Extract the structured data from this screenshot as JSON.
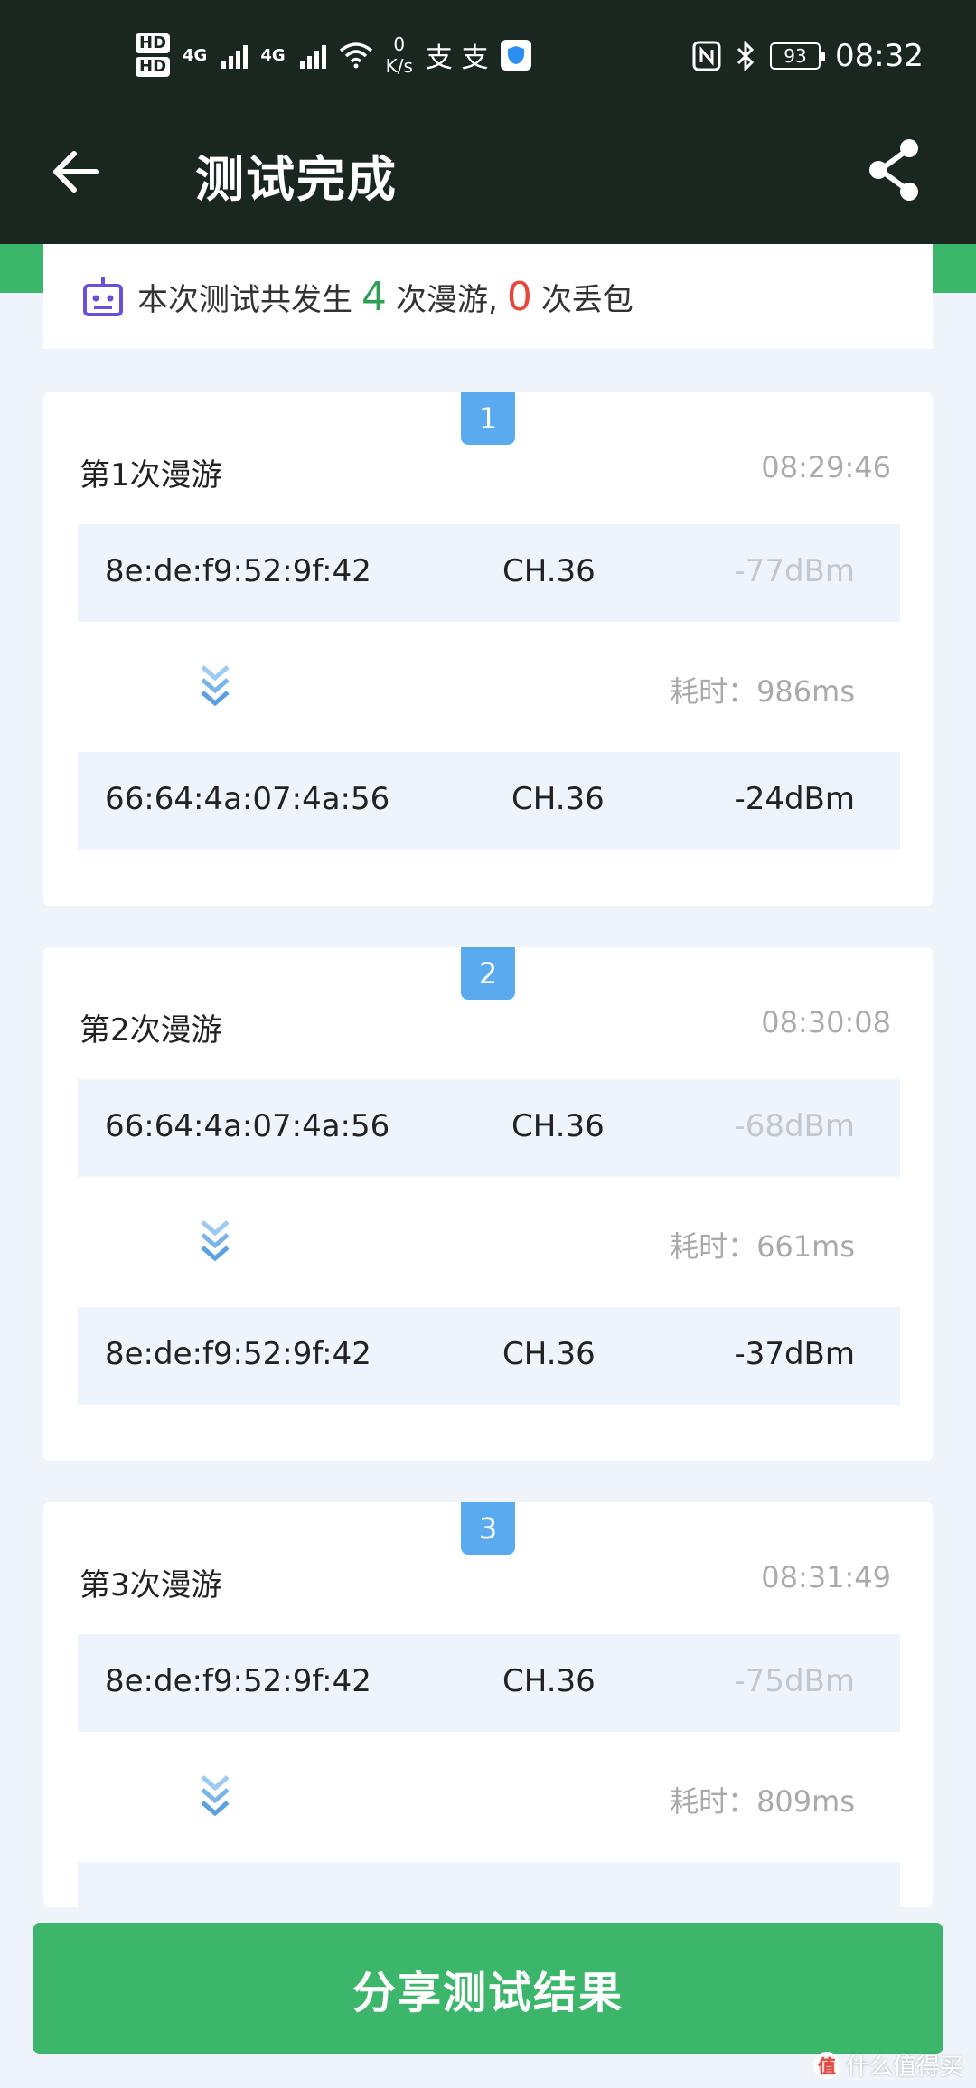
{
  "status_bar": {
    "sim1": "HD",
    "sim2": "HD",
    "sim1_net": "4G",
    "sim2_net": "4G",
    "net_speed_value": "0",
    "net_speed_unit": "K/s",
    "glyphs": "支 支",
    "battery": "93",
    "time": "08:32"
  },
  "app_bar": {
    "title": "测试完成"
  },
  "summary": {
    "prefix": "本次测试共发生",
    "roam_count": "4",
    "roam_label": "次漫游,",
    "loss_count": "0",
    "loss_label": "次丢包"
  },
  "roams": [
    {
      "index": "1",
      "title": "第1次漫游",
      "time": "08:29:46",
      "from": {
        "mac": "8e:de:f9:52:9f:42",
        "channel": "CH.36",
        "signal": "-77dBm"
      },
      "elapsed": "耗时：986ms",
      "to": {
        "mac": "66:64:4a:07:4a:56",
        "channel": "CH.36",
        "signal": "-24dBm"
      }
    },
    {
      "index": "2",
      "title": "第2次漫游",
      "time": "08:30:08",
      "from": {
        "mac": "66:64:4a:07:4a:56",
        "channel": "CH.36",
        "signal": "-68dBm"
      },
      "elapsed": "耗时：661ms",
      "to": {
        "mac": "8e:de:f9:52:9f:42",
        "channel": "CH.36",
        "signal": "-37dBm"
      }
    },
    {
      "index": "3",
      "title": "第3次漫游",
      "time": "08:31:49",
      "from": {
        "mac": "8e:de:f9:52:9f:42",
        "channel": "CH.36",
        "signal": "-75dBm"
      },
      "elapsed": "耗时：809ms"
    }
  ],
  "bottom_button": {
    "label": "分享测试结果"
  },
  "watermark": {
    "logo": "值",
    "text": "什么值得买"
  },
  "colors": {
    "header_bg": "#1a2620",
    "accent_green": "#3cb66a",
    "count_green": "#2e9e55",
    "count_red": "#e8453c",
    "badge_blue": "#5aaaf0"
  }
}
